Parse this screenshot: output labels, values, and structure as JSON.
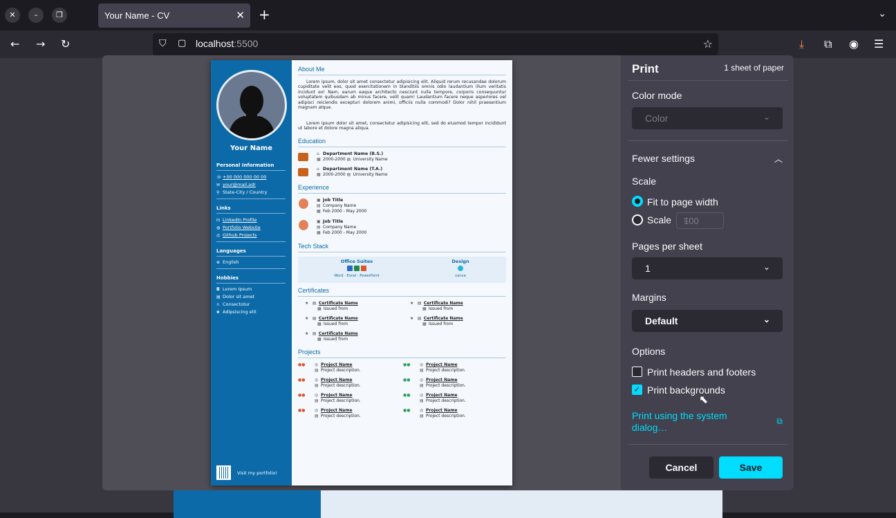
{
  "browser": {
    "tab_title": "Your Name - CV",
    "url_host": "localhost",
    "url_port": ":5500"
  },
  "cv": {
    "name": "Your Name",
    "personal_heading": "Personal Information",
    "phone": "+00 000 000 00 00",
    "email": "your@mail.adr",
    "location": "State-City / Country",
    "links_heading": "Links",
    "links": [
      "LinkedIn Profile",
      "Portfolio Website",
      "Github Projects"
    ],
    "languages_heading": "Languages",
    "language": "English",
    "hobbies_heading": "Hobbies",
    "hobbies": [
      "Lorem Ipsum",
      "Dolor sit amet",
      "Consectotur",
      "Adipsiscing elit"
    ],
    "visit": "Visit my portfolio!",
    "about_heading": "About Me",
    "about_p1": "Lorem ipsum, dolor sit amet consectetur adipisicing elit. Aliquid rerum recusandae dolorum cupiditate velit eos, quod exercitationem in blanditiis omnis odio laudantium illum veritatis incidunt ex! Nam, earum eaque architecto nesciunt nulla tempore, corporis consequuntur voluptatem quibusdam ab minus facere, velit quam! Laudantium facere neque asperiores vel adipisci reiciendis excepturi dolorem animi, officiis nulla commodi? Dolor nihil praesentium magnam atque.",
    "about_p2": "Lorem ipsum dolor sit amet, consectetur adipisicing elit, sed do eiusmod tempor incididunt ut labore et dolore magna aliqua.",
    "education_heading": "Education",
    "education": [
      {
        "title": "Department Name (B.S.)",
        "years": "2000-2000",
        "school": "University Name"
      },
      {
        "title": "Department Name (T.A.)",
        "years": "2000-2000",
        "school": "University Name"
      }
    ],
    "experience_heading": "Experience",
    "experience": [
      {
        "title": "Job Title",
        "company": "Company Name",
        "dates": "Feb 2000 - May 2000"
      },
      {
        "title": "Job Title",
        "company": "Company Name",
        "dates": "Feb 2000 - May 2000"
      }
    ],
    "techstack_heading": "Tech Stack",
    "techstack": [
      {
        "group": "Office Suites",
        "items": "Word · Excel · PowerPoint"
      },
      {
        "group": "Design",
        "items": "canva"
      }
    ],
    "certificates_heading": "Certificates",
    "certificates": [
      {
        "name": "Certificate Name",
        "issuer": "Issued from"
      },
      {
        "name": "Certificate Name",
        "issuer": "Issued from"
      },
      {
        "name": "Certificate Name",
        "issuer": "Issued from"
      },
      {
        "name": "Certificate Name",
        "issuer": "Issued from"
      },
      {
        "name": "Certificate Name",
        "issuer": "Issued from"
      }
    ],
    "projects_heading": "Projects",
    "projects": [
      {
        "name": "Project Name",
        "desc": "Project description."
      },
      {
        "name": "Project Name",
        "desc": "Project description."
      },
      {
        "name": "Project Name",
        "desc": "Project description."
      },
      {
        "name": "Project Name",
        "desc": "Project description."
      },
      {
        "name": "Project Name",
        "desc": "Project description."
      },
      {
        "name": "Project Name",
        "desc": "Project description."
      },
      {
        "name": "Project Name",
        "desc": "Project description."
      },
      {
        "name": "Project Name",
        "desc": "Project description."
      }
    ]
  },
  "print": {
    "title": "Print",
    "sheets": "1 sheet of paper",
    "color_mode_label": "Color mode",
    "color_mode_value": "Color",
    "fewer_settings": "Fewer settings",
    "scale_label": "Scale",
    "fit_label": "Fit to page width",
    "scale_option": "Scale",
    "scale_value": "100",
    "pages_per_sheet_label": "Pages per sheet",
    "pages_per_sheet_value": "1",
    "margins_label": "Margins",
    "margins_value": "Default",
    "options_label": "Options",
    "headers_footers": "Print headers and footers",
    "backgrounds": "Print backgrounds",
    "headers_footers_checked": false,
    "backgrounds_checked": true,
    "system_dialog": "Print using the system dialog…",
    "cancel": "Cancel",
    "save": "Save"
  },
  "colors": {
    "accent": "#00ddff",
    "cv_blue": "#0c6aa8"
  }
}
